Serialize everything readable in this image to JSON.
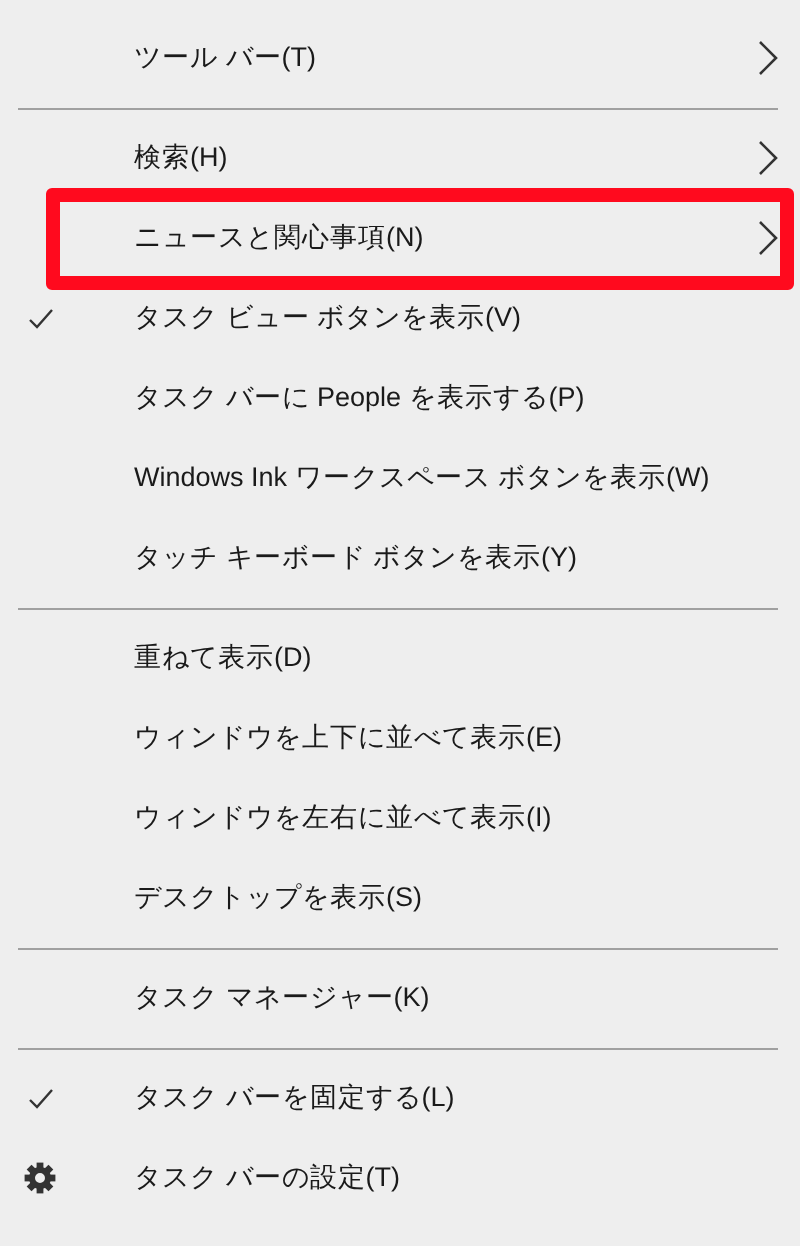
{
  "menu": {
    "items": [
      {
        "kind": "command",
        "label": "ツール バー(T)",
        "checked": false,
        "has_submenu": true,
        "highlighted": false
      },
      {
        "kind": "separator"
      },
      {
        "kind": "command",
        "label": "検索(H)",
        "checked": false,
        "has_submenu": true,
        "highlighted": false
      },
      {
        "kind": "command",
        "label": "ニュースと関心事項(N)",
        "checked": false,
        "has_submenu": true,
        "highlighted": true
      },
      {
        "kind": "command",
        "label": "タスク ビュー ボタンを表示(V)",
        "checked": true,
        "has_submenu": false,
        "highlighted": false
      },
      {
        "kind": "command",
        "label": "タスク バーに People を表示する(P)",
        "checked": false,
        "has_submenu": false,
        "highlighted": false
      },
      {
        "kind": "command",
        "label": "Windows Ink ワークスペース ボタンを表示(W)",
        "checked": false,
        "has_submenu": false,
        "highlighted": false
      },
      {
        "kind": "command",
        "label": "タッチ キーボード ボタンを表示(Y)",
        "checked": false,
        "has_submenu": false,
        "highlighted": false
      },
      {
        "kind": "separator"
      },
      {
        "kind": "command",
        "label": "重ねて表示(D)",
        "checked": false,
        "has_submenu": false,
        "highlighted": false
      },
      {
        "kind": "command",
        "label": "ウィンドウを上下に並べて表示(E)",
        "checked": false,
        "has_submenu": false,
        "highlighted": false
      },
      {
        "kind": "command",
        "label": "ウィンドウを左右に並べて表示(I)",
        "checked": false,
        "has_submenu": false,
        "highlighted": false
      },
      {
        "kind": "command",
        "label": "デスクトップを表示(S)",
        "checked": false,
        "has_submenu": false,
        "highlighted": false
      },
      {
        "kind": "separator"
      },
      {
        "kind": "command",
        "label": "タスク マネージャー(K)",
        "checked": false,
        "has_submenu": false,
        "highlighted": false
      },
      {
        "kind": "separator"
      },
      {
        "kind": "command",
        "label": "タスク バーを固定する(L)",
        "checked": true,
        "has_submenu": false,
        "highlighted": false
      },
      {
        "kind": "settings",
        "label": "タスク バーの設定(T)",
        "has_submenu": false,
        "highlighted": false
      }
    ]
  }
}
